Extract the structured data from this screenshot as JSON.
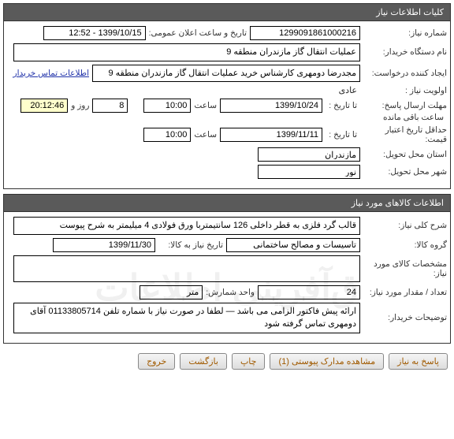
{
  "section1": {
    "title": "کلیات اطلاعات نیاز",
    "need_no_label": "شماره نیاز:",
    "need_no": "1299091861000216",
    "announce_label": "تاریخ و ساعت اعلان عمومی:",
    "announce_val": "1399/10/15 - 12:52",
    "buyer_label": "نام دستگاه خریدار:",
    "buyer_val": "عملیات انتقال گاز مازندران منطقه 9",
    "creator_label": "ایجاد کننده درخواست:",
    "creator_val": "مجدرضا دومهری کارشناس خرید عملیات انتقال گاز مازندران منطقه 9",
    "contact_link": "اطلاعات تماس خریدار",
    "priority_label": "اولویت نیاز :",
    "priority_val": "عادی",
    "deadline_label": "مهلت ارسال پاسخ:",
    "until_label": "تا تاریخ :",
    "deadline_date": "1399/10/24",
    "time_label": "ساعت",
    "deadline_time": "10:00",
    "days_val": "8",
    "days_label": "روز و",
    "remain_time": "20:12:46",
    "remain_label": "ساعت باقی مانده",
    "min_valid_label": "حداقل تاریخ اعتبار قیمت:",
    "min_valid_until": "تا تاریخ :",
    "min_valid_date": "1399/11/11",
    "min_valid_time": "10:00",
    "province_label": "استان محل تحویل:",
    "province_val": "مازندران",
    "city_label": "شهر محل تحویل:",
    "city_val": "نور"
  },
  "section2": {
    "title": "اطلاعات کالاهای مورد نیاز",
    "desc_label": "شرح کلی نیاز:",
    "desc_val": "قالب گرد فلزی به قطر داخلی 126 سانتیمتربا ورق فولادی 4 میلیمتر به شرح پیوست",
    "group_label": "گروه کالا:",
    "group_val": "تاسیسات و مصالح ساختمانی",
    "need_date_label": "تاریخ نیاز به کالا:",
    "need_date_val": "1399/11/30",
    "spec_label": "مشخصات کالای مورد نیاز:",
    "spec_val": "",
    "qty_label": "تعداد / مقدار مورد نیاز:",
    "qty_val": "24",
    "unit_label": "واحد شمارش:",
    "unit_val": "متر",
    "buyer_notes_label": "توضیحات خریدار:",
    "buyer_notes_val": "ارائه پیش فاکتور الزامی می باشد — لطفا در صورت نیاز با شماره تلفن 01133805714 آقای دومهری تماس گرفته شود"
  },
  "buttons": {
    "respond": "پاسخ به نیاز",
    "attachments": "مشاهده مدارک پیوستی  (1)",
    "print": "چاپ",
    "back": "بازگشت",
    "exit": "خروج"
  }
}
